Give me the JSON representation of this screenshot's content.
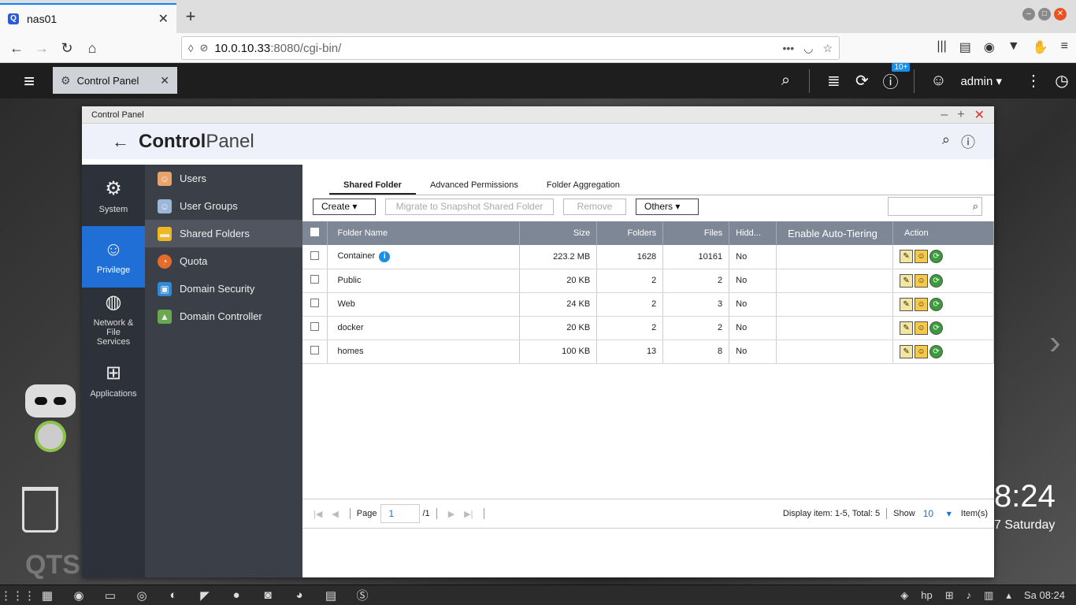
{
  "browser": {
    "tab_title": "nas01",
    "url_host": "10.0.10.33",
    "url_rest": ":8080/cgi-bin/"
  },
  "qts": {
    "open_tab": "Control Panel",
    "notification_badge": "10+",
    "user": "admin",
    "clock": "8:24",
    "date": "7 Saturday",
    "logo": "QTS"
  },
  "window": {
    "title": "Control Panel",
    "brand_bold": "Control",
    "brand_rest": "Panel"
  },
  "left_nav": [
    {
      "label": "System",
      "icon": "gear-icon"
    },
    {
      "label": "Privilege",
      "icon": "user-icon"
    },
    {
      "label": "Network & File Services",
      "icon": "globe-icon"
    },
    {
      "label": "Applications",
      "icon": "grid-icon"
    }
  ],
  "sub_nav": [
    {
      "label": "Users",
      "icon": "user-icon"
    },
    {
      "label": "User Groups",
      "icon": "users-icon"
    },
    {
      "label": "Shared Folders",
      "icon": "folder-icon"
    },
    {
      "label": "Quota",
      "icon": "pie-icon"
    },
    {
      "label": "Domain Security",
      "icon": "briefcase-icon"
    },
    {
      "label": "Domain Controller",
      "icon": "network-icon"
    }
  ],
  "tabs": [
    "Shared Folder",
    "Advanced Permissions",
    "Folder Aggregation"
  ],
  "toolbar": {
    "create": "Create",
    "migrate": "Migrate to Snapshot Shared Folder",
    "remove": "Remove",
    "others": "Others"
  },
  "table": {
    "headers": [
      "Folder Name",
      "Size",
      "Folders",
      "Files",
      "Hidd...",
      "Enable Auto-Tiering",
      "Action"
    ],
    "rows": [
      {
        "name": "Container",
        "size": "223.2 MB",
        "folders": "1628",
        "files": "10161",
        "hidden": "No"
      },
      {
        "name": "Public",
        "size": "20 KB",
        "folders": "2",
        "files": "2",
        "hidden": "No"
      },
      {
        "name": "Web",
        "size": "24 KB",
        "folders": "2",
        "files": "3",
        "hidden": "No"
      },
      {
        "name": "docker",
        "size": "20 KB",
        "folders": "2",
        "files": "2",
        "hidden": "No"
      },
      {
        "name": "homes",
        "size": "100 KB",
        "folders": "13",
        "files": "8",
        "hidden": "No"
      }
    ]
  },
  "pager": {
    "page_label": "Page",
    "page_value": "1",
    "page_total": "/1",
    "display": "Display item: 1-5, Total: 5",
    "show_label": "Show",
    "show_value": "10",
    "items_label": "Item(s)"
  },
  "taskbar": {
    "clock": "Sa 08:24"
  }
}
